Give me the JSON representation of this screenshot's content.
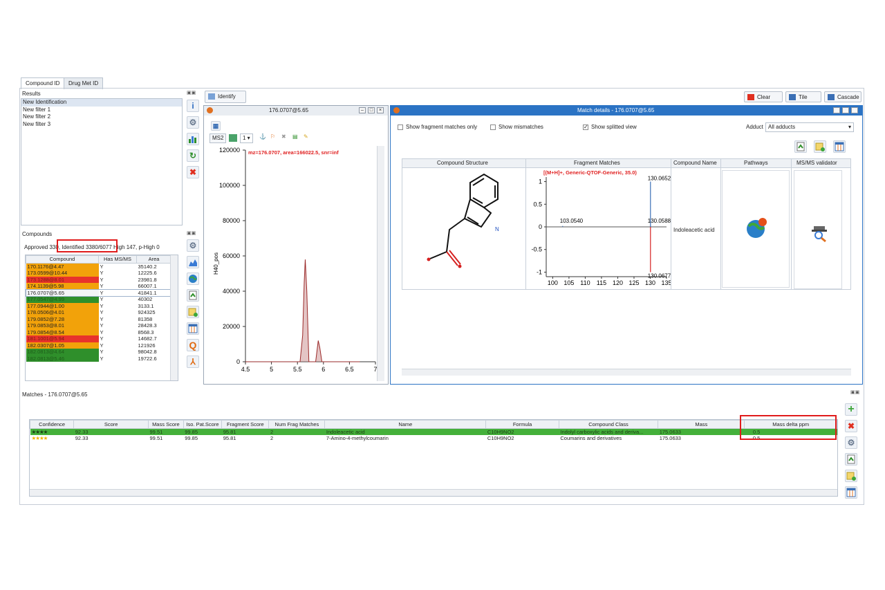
{
  "tabs": [
    {
      "label": "Compound ID",
      "active": true
    },
    {
      "label": "Drug Met ID",
      "active": false
    }
  ],
  "results": {
    "title": "Results",
    "items": [
      "New Identification",
      "New filter 1",
      "New filter 2",
      "New filter 3"
    ]
  },
  "compounds": {
    "title": "Compounds",
    "summary_approved": "Approved 330",
    "summary_identified": ", Identified 3380/6077",
    "summary_rest": "High 147, p-High 0",
    "columns": [
      "Compound",
      "Has MS/MS",
      "Area"
    ],
    "rows": [
      {
        "compound": "170.1176@4.47",
        "msms": "Y",
        "area": "35140.2",
        "status": "orange"
      },
      {
        "compound": "173.0599@10.44",
        "msms": "Y",
        "area": "12225.6",
        "status": "orange"
      },
      {
        "compound": "173.1288@8.01",
        "msms": "Y",
        "area": "23981.8",
        "status": "red"
      },
      {
        "compound": "174.1139@5.98",
        "msms": "Y",
        "area": "66007.1",
        "status": "orange"
      },
      {
        "compound": "176.0707@5.65",
        "msms": "Y",
        "area": "41841.1",
        "status": "white"
      },
      {
        "compound": "177.0547@4.99",
        "msms": "Y",
        "area": "40302",
        "status": "green"
      },
      {
        "compound": "177.0944@1.00",
        "msms": "Y",
        "area": "3133.1",
        "status": "orange"
      },
      {
        "compound": "178.0506@4.01",
        "msms": "Y",
        "area": "924325",
        "status": "orange"
      },
      {
        "compound": "179.0852@7.28",
        "msms": "Y",
        "area": "81358",
        "status": "orange"
      },
      {
        "compound": "179.0853@8.01",
        "msms": "Y",
        "area": "28428.3",
        "status": "orange"
      },
      {
        "compound": "179.0854@8.54",
        "msms": "Y",
        "area": "8568.3",
        "status": "orange"
      },
      {
        "compound": "181.1001@5.94",
        "msms": "Y",
        "area": "14682.7",
        "status": "red"
      },
      {
        "compound": "182.0307@1.05",
        "msms": "Y",
        "area": "121926",
        "status": "orange"
      },
      {
        "compound": "182.0813@4.64",
        "msms": "Y",
        "area": "98042.8",
        "status": "green"
      },
      {
        "compound": "182.0813@5.46",
        "msms": "Y",
        "area": "19722.6",
        "status": "green"
      }
    ]
  },
  "toolbar": {
    "identify_label": "Identify ...",
    "clear_label": "Clear",
    "tile_label": "Tile",
    "cascade_label": "Cascade"
  },
  "spectrum_window": {
    "title": "176.0707@5.65",
    "ms_level": "MS2",
    "scan_select": "1",
    "annotation": "mz=176.0707, area=166022.5, snr=inf",
    "y_axis_label": "H40_pos",
    "chart_data": {
      "type": "line",
      "x_ticks": [
        "4.5",
        "5",
        "5.5",
        "6",
        "6.5",
        "7"
      ],
      "y_ticks": [
        "0",
        "20000",
        "40000",
        "60000",
        "80000",
        "100000",
        "120000"
      ],
      "xlim": [
        4.5,
        7
      ],
      "ylim": [
        0,
        120000
      ],
      "series": [
        {
          "x": [
            4.5,
            5.55,
            5.6,
            5.63,
            5.65,
            5.68,
            5.72,
            5.85,
            5.9,
            5.93,
            5.97,
            6.7
          ],
          "y": [
            0,
            0,
            15000,
            45000,
            58000,
            40000,
            0,
            0,
            12000,
            8000,
            0,
            0
          ]
        }
      ]
    }
  },
  "match_details": {
    "title": "Match details - 176.0707@5.65",
    "show_fragment_label": "Show fragment matches only",
    "show_mismatches_label": "Show mismatches",
    "show_split_label": "Show splitted view",
    "adduct_label": "Adduct",
    "adduct_value": "All adducts",
    "columns": [
      "Compound Structure",
      "Fragment Matches",
      "Compound Name",
      "Pathways",
      "MS/MS validator"
    ],
    "compound_name": "Indoleacetic acid",
    "fragment_chart": {
      "type": "bar",
      "title": "[(M+H]+, Generic-QTOF-Generic, 35.0)",
      "x_ticks": [
        "100",
        "105",
        "110",
        "115",
        "120",
        "125",
        "130",
        "135"
      ],
      "y_ticks": [
        "1",
        "0.5",
        "0",
        "-0.5",
        "-1"
      ],
      "xlim": [
        98,
        135
      ],
      "ylim": [
        -1.1,
        1.1
      ],
      "peaks": [
        {
          "x": 103.054,
          "y": 0.02,
          "label": "103.0540"
        },
        {
          "x": 130.0652,
          "y": 1.0,
          "label": "130.0652"
        },
        {
          "x": 130.0588,
          "y": 0.02,
          "label": "130.0588"
        },
        {
          "x": 130.0677,
          "y": -1.0,
          "label": "130.0677"
        }
      ]
    }
  },
  "matches": {
    "title": "Matches - 176.0707@5.65",
    "columns": [
      "Confidence",
      "Score",
      "Mass Score",
      "Iso. Pat.Score",
      "Fragment Score",
      "Num Frag Matches",
      "Name",
      "Formula",
      "Compound Class",
      "Mass",
      "Mass delta ppm"
    ],
    "rows": [
      {
        "stars": "★★★★",
        "score": "92.33",
        "mass_score": "99.51",
        "iso": "99.85",
        "frag": "95.81",
        "num": "2",
        "name": "Indoleacetic acid",
        "formula": "C10H9NO2",
        "class": "Indolyl carboxylic acids and deriva...",
        "mass": "175.0633",
        "delta": "0.5"
      },
      {
        "stars": "★★★★",
        "score": "92.33",
        "mass_score": "99.51",
        "iso": "99.85",
        "frag": "95.81",
        "num": "2",
        "name": "7-Amino-4-methylcoumarin",
        "formula": "C10H9NO2",
        "class": "Coumarins and derivatives",
        "mass": "175.0633",
        "delta": "0.5"
      }
    ]
  },
  "colors": {
    "orange": "#f2a20a",
    "red": "#e8332b",
    "green": "#2f8f2b",
    "highlight": "#e01b1b",
    "titlebar": "#2b73c4"
  }
}
